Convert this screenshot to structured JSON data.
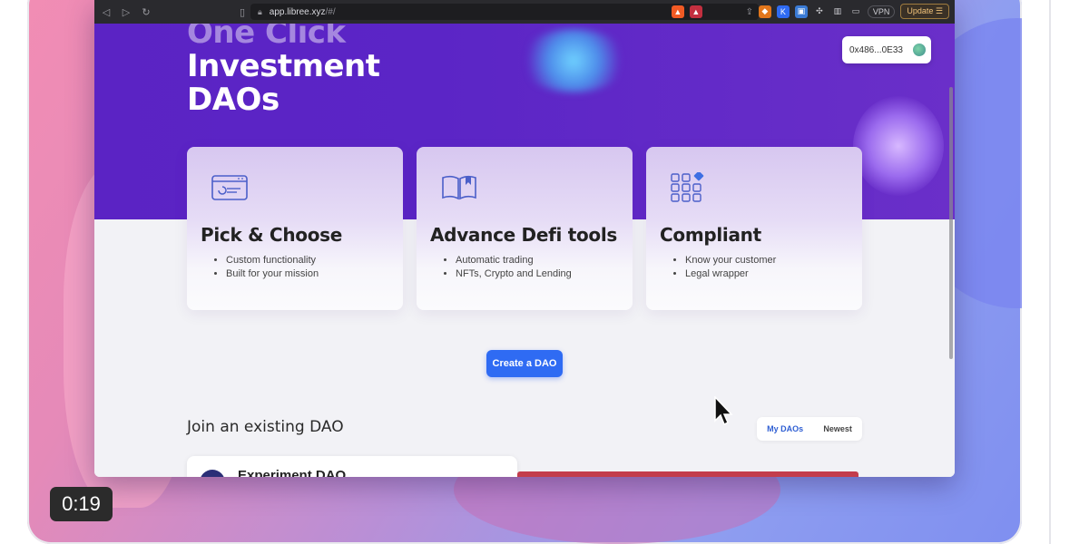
{
  "browser": {
    "url": "app.libree.xyz",
    "url_suffix": "/#/",
    "vpn_label": "VPN",
    "update_label": "Update"
  },
  "hero": {
    "title_line1": "One Click",
    "title_line2": "Investment",
    "title_line3": "DAOs",
    "wallet_address": "0x486...0E33"
  },
  "features": [
    {
      "title": "Pick & Choose",
      "bullets": [
        "Custom functionality",
        "Built for your mission"
      ]
    },
    {
      "title": "Advance Defi tools",
      "bullets": [
        "Automatic trading",
        "NFTs, Crypto and Lending"
      ]
    },
    {
      "title": "Compliant",
      "bullets": [
        "Know your customer",
        "Legal wrapper"
      ]
    }
  ],
  "cta": {
    "label": "Create a DAO"
  },
  "join": {
    "heading": "Join an existing DAO",
    "tabs": [
      "My DAOs",
      "Newest"
    ],
    "first_dao_name": "Experiment DAO"
  },
  "video": {
    "timestamp": "0:19"
  },
  "colors": {
    "hero_purple": "#5b23c4",
    "primary_blue": "#2f6bf3",
    "active_tab": "#2f5fd3"
  }
}
